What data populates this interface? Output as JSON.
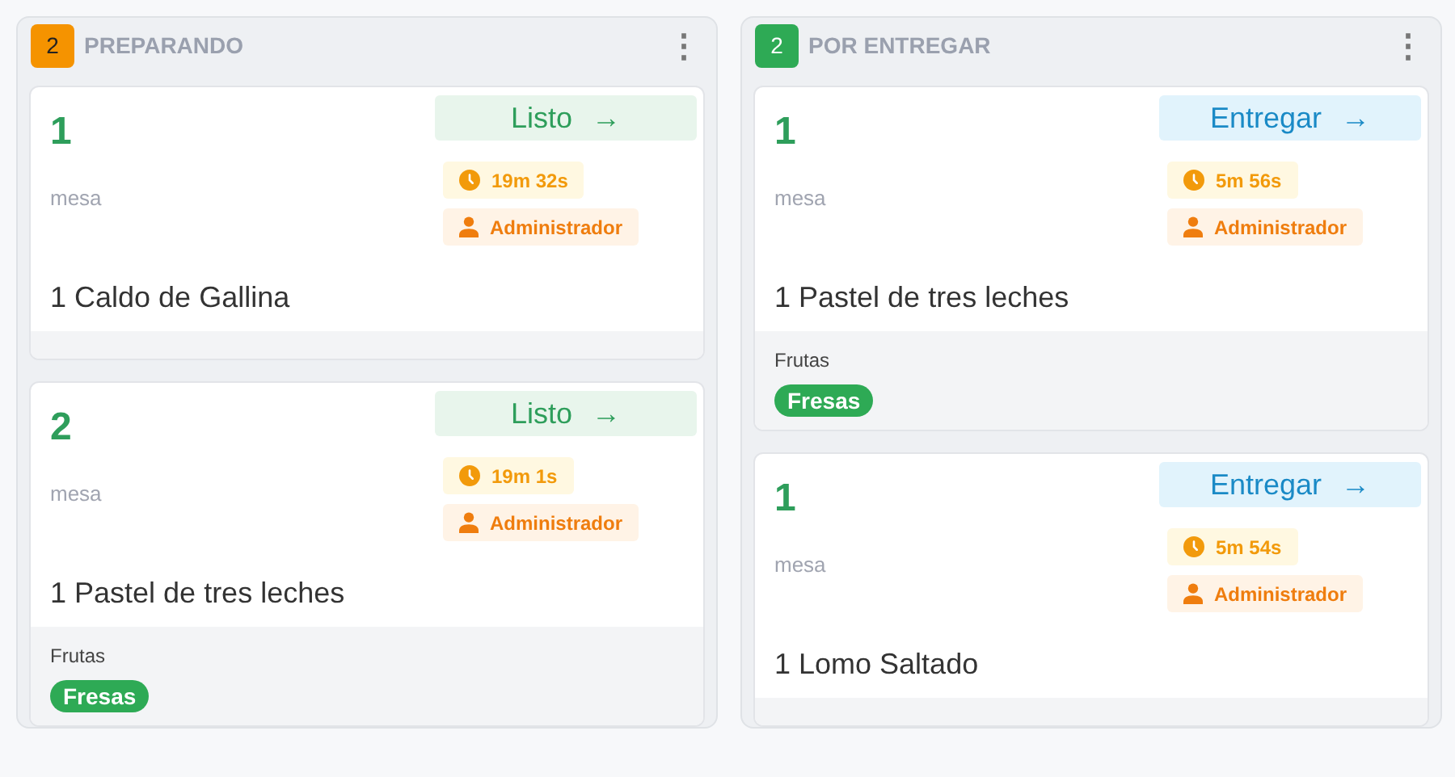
{
  "columns": [
    {
      "count": "2",
      "color": "#f59300",
      "title": "PREPARANDO",
      "menu_icon": "⋮",
      "cards": [
        {
          "number": "1",
          "label": "mesa",
          "action": {
            "kind": "ready",
            "label": "Listo",
            "icon": "→"
          },
          "time": "19m 32s",
          "user": "Administrador",
          "item": "1 Caldo de Gallina"
        },
        {
          "number": "2",
          "label": "mesa",
          "action": {
            "kind": "ready",
            "label": "Listo",
            "icon": "→"
          },
          "time": "19m 1s",
          "user": "Administrador",
          "item": "1 Pastel de tres leches",
          "extras": [
            {
              "group": "Frutas",
              "tags": [
                "Fresas"
              ]
            }
          ]
        }
      ]
    },
    {
      "count": "2",
      "color": "#2eaa55",
      "title": "POR ENTREGAR",
      "menu_icon": "⋮",
      "cards": [
        {
          "number": "1",
          "label": "mesa",
          "action": {
            "kind": "deliver",
            "label": "Entregar",
            "icon": "→"
          },
          "time": "5m 56s",
          "user": "Administrador",
          "item": "1 Pastel de tres leches",
          "extras": [
            {
              "group": "Frutas",
              "tags": [
                "Fresas"
              ]
            }
          ]
        },
        {
          "number": "1",
          "label": "mesa",
          "action": {
            "kind": "deliver",
            "label": "Entregar",
            "icon": "→"
          },
          "time": "5m 54s",
          "user": "Administrador",
          "item": "1 Lomo Saltado"
        }
      ]
    }
  ]
}
